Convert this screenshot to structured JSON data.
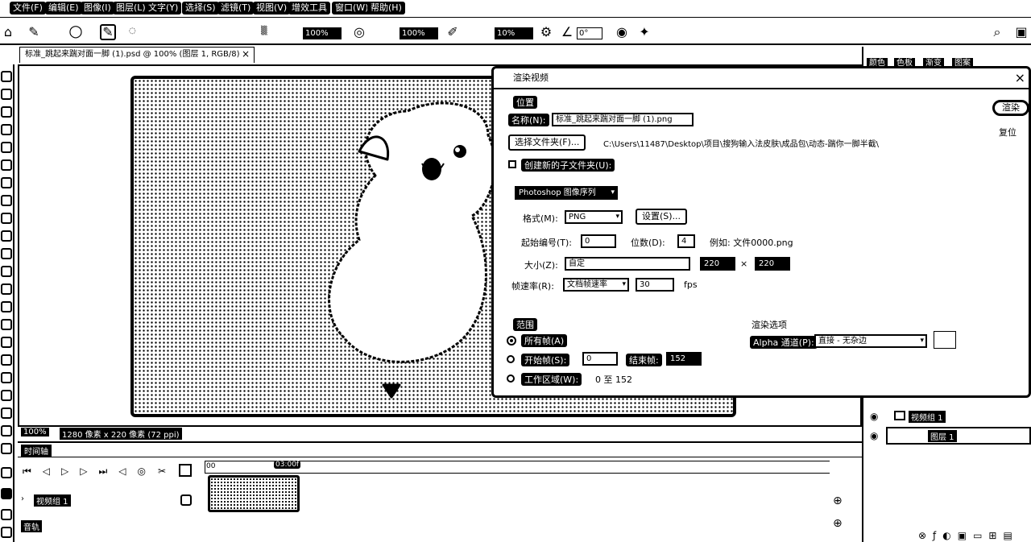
{
  "menu": [
    "文件(F)",
    "编辑(E)",
    "图像(I)",
    "图层(L)",
    "文字(Y)",
    "选择(S)",
    "滤镜(T)",
    "视图(V)",
    "增效工具",
    "窗口(W)",
    "帮助(H)"
  ],
  "options_bar": {
    "field_a": "100%",
    "field_b": "100%",
    "field_c": "10%",
    "angle": "0°"
  },
  "document_tab": "标准_跳起来踹对面一脚 (1).psd @ 100% (图层 1, RGB/8)",
  "status": {
    "zoom": "100%",
    "dimensions": "1280 像素 x 220 像素 (72 ppi)"
  },
  "timeline": {
    "title": "时间轴",
    "time_marker": "00",
    "playhead": "03:00f",
    "track_label": "视频组 1",
    "track_label2": "音轨"
  },
  "right_panel": {
    "tabs": [
      "颜色",
      "色板",
      "渐变",
      "图案"
    ],
    "layers": [
      {
        "name": "视频组 1"
      },
      {
        "name": "图层 1"
      }
    ]
  },
  "dialog": {
    "title": "渲染视频",
    "location_section": "位置",
    "name_label": "名称(N):",
    "name_value": "标准_跳起来踹对面一脚 (1).png",
    "select_folder_btn": "选择文件夹(F)...",
    "folder_path": "C:\\Users\\11487\\Desktop\\项目\\搜狗输入法皮肤\\成品包\\动态-踹你一脚半截\\",
    "create_subfolder": "创建新的子文件夹(U):",
    "export_type": "Photoshop 图像序列",
    "format_label": "格式(M):",
    "format_value": "PNG",
    "settings_btn": "设置(S)...",
    "start_num_label": "起始编号(T):",
    "start_num_value": "0",
    "digits_label": "位数(D):",
    "digits_value": "4",
    "example": "例如: 文件0000.png",
    "size_label": "大小(Z):",
    "size_value": "自定",
    "width": "220",
    "height": "220",
    "framerate_label": "帧速率(R):",
    "framerate_value": "文档帧速率",
    "fps_value": "30",
    "fps_unit": "fps",
    "range_section": "范围",
    "all_frames": "所有帧(A)",
    "start_frame_label": "开始帧(S):",
    "start_frame_value": "0",
    "end_frame_label": "结束帧:",
    "end_frame_value": "152",
    "work_area_label": "工作区域(W):",
    "work_area_value": "0 至 152",
    "render_options": "渲染选项",
    "alpha_label": "Alpha 通道(P):",
    "alpha_value": "直接 - 无杂边",
    "render_btn": "渲染",
    "reset_btn": "复位"
  }
}
